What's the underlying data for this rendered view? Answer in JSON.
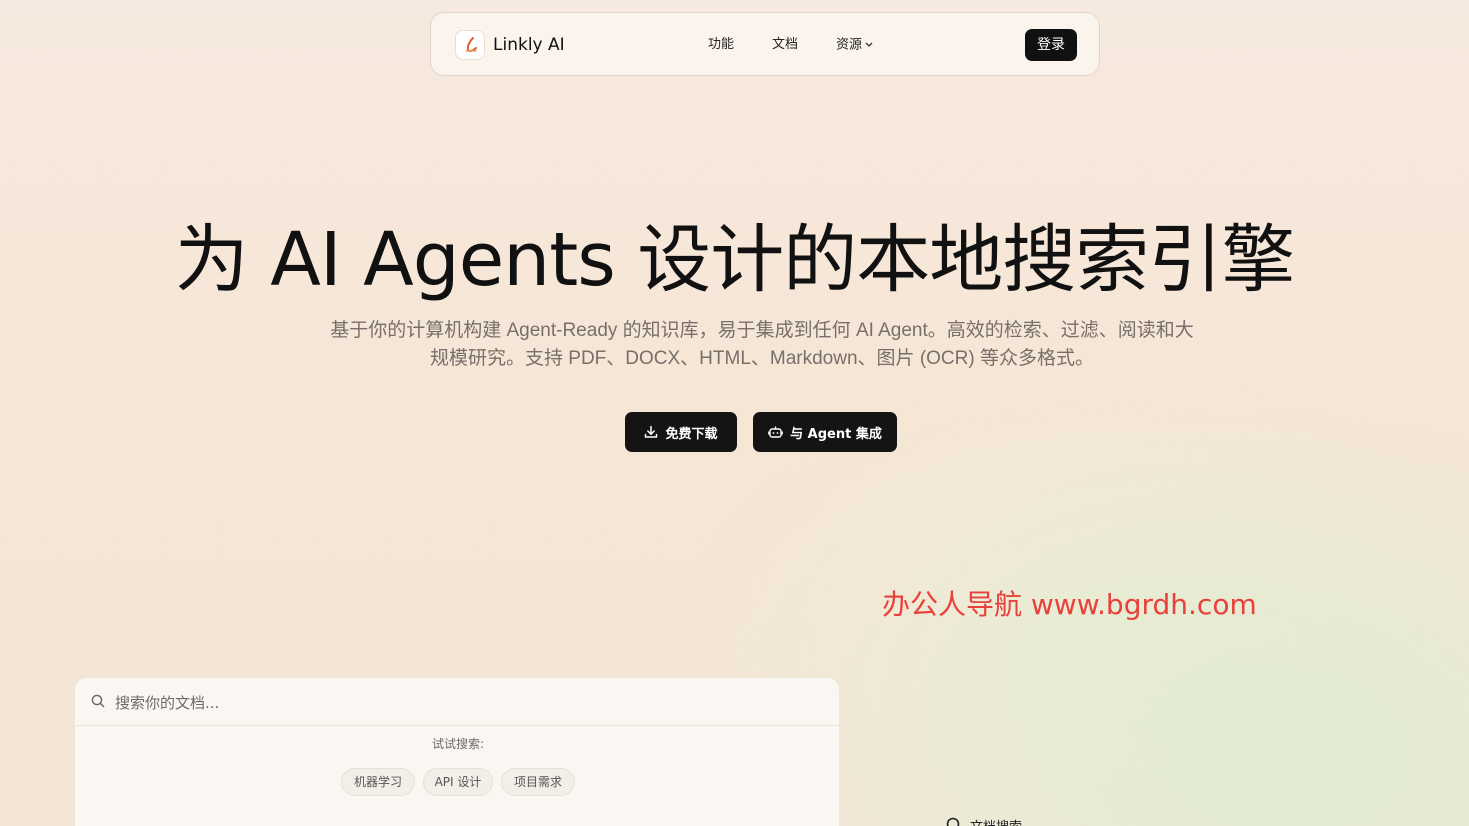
{
  "nav": {
    "brand": "Linkly AI",
    "links": {
      "features": "功能",
      "docs": "文档",
      "resources": "资源"
    },
    "login": "登录"
  },
  "hero": {
    "title": "为 AI Agents 设计的本地搜索引擎",
    "subtitle_line1": "基于你的计算机构建 Agent-Ready 的知识库，易于集成到任何 AI Agent。高效的检索、过滤、阅读和大",
    "subtitle_line2": "规模研究。支持 PDF、DOCX、HTML、Markdown、图片 (OCR) 等众多格式。",
    "cta_download": "免费下载",
    "cta_agent": "与 Agent 集成"
  },
  "watermark": "办公人导航 www.bgrdh.com",
  "demo": {
    "search_placeholder": "搜索你的文档...",
    "try_label": "试试搜索:",
    "chips": [
      "机器学习",
      "API 设计",
      "项目需求"
    ]
  },
  "feature_peek": {
    "label": "文档搜索"
  },
  "colors": {
    "accent_dark": "#111111",
    "watermark": "#e8413a",
    "logo_stroke": "#e0602a"
  },
  "icons": {
    "logo": "linkly-logo-icon",
    "resources_dropdown": "chevron-down-icon",
    "download": "download-icon",
    "agent": "robot-icon",
    "search": "search-icon"
  }
}
